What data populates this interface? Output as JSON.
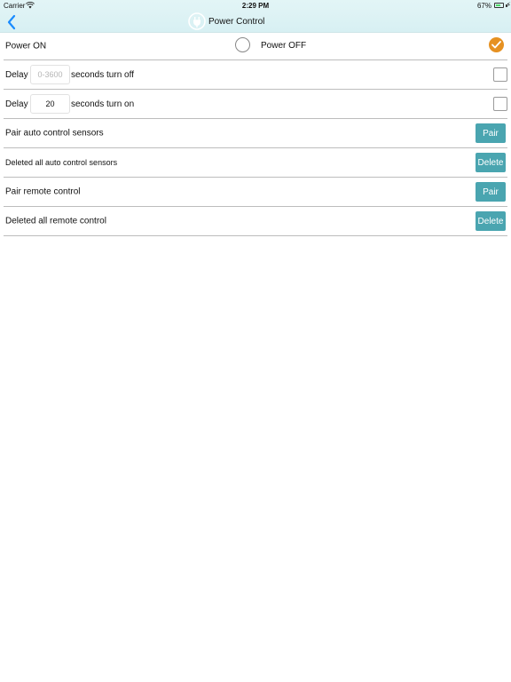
{
  "status_bar": {
    "carrier": "Carrier",
    "time": "2:29 PM",
    "battery": "67%",
    "battery_level": 0.67,
    "charging_symbol": "⚡"
  },
  "nav": {
    "title": "Power Control",
    "back_icon": "chevron-left-icon",
    "logo_icon": "power-plug-icon",
    "accent_color": "#1a8cff"
  },
  "power": {
    "on_label": "Power ON",
    "off_label": "Power OFF",
    "selected": "on",
    "selected_color": "#e69121"
  },
  "delay_off": {
    "label": "Delay",
    "value": "",
    "placeholder": "0-3600",
    "suffix": "seconds turn off",
    "checked": false
  },
  "delay_on": {
    "label": "Delay",
    "value": "20",
    "placeholder": "",
    "suffix": "seconds turn on",
    "checked": false
  },
  "actions": [
    {
      "label": "Pair auto control sensors",
      "button": "Pair"
    },
    {
      "label": "Deleted all auto control sensors",
      "button": "Delete"
    },
    {
      "label": "Pair remote control",
      "button": "Pair"
    },
    {
      "label": "Deleted all remote control",
      "button": "Delete"
    }
  ],
  "button_color": "#4aa5b0"
}
